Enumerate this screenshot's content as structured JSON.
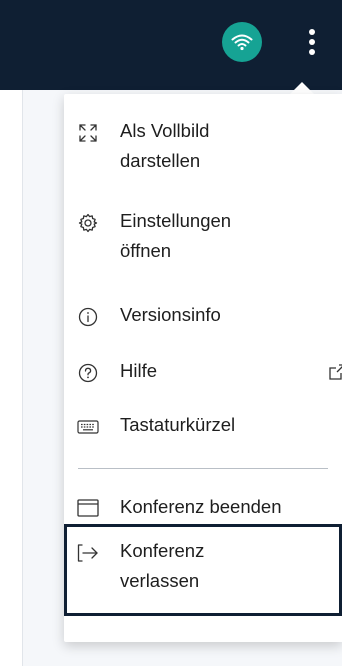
{
  "menu": {
    "items": [
      {
        "id": "fullscreen",
        "line1": "Als Vollbild",
        "line2": "darstellen",
        "icon": "fullscreen-icon"
      },
      {
        "id": "settings",
        "line1": "Einstellungen",
        "line2": "öffnen",
        "icon": "gear-icon"
      },
      {
        "id": "version",
        "line1": "Versionsinfo",
        "icon": "info-icon"
      },
      {
        "id": "help",
        "line1": "Hilfe",
        "icon": "help-icon",
        "trailing_icon": "external-link-icon"
      },
      {
        "id": "shortcuts",
        "line1": "Tastaturkürzel",
        "icon": "keyboard-icon"
      },
      {
        "id": "end-conference",
        "line1": "Konferenz beenden",
        "icon": "window-icon"
      },
      {
        "id": "leave-conference",
        "line1": "Konferenz",
        "line2": "verlassen",
        "icon": "exit-icon",
        "focused": true
      }
    ]
  },
  "colors": {
    "topbar": "#0f1f33",
    "wifi_button": "#16a394",
    "focus_outline": "#0f1f33"
  }
}
